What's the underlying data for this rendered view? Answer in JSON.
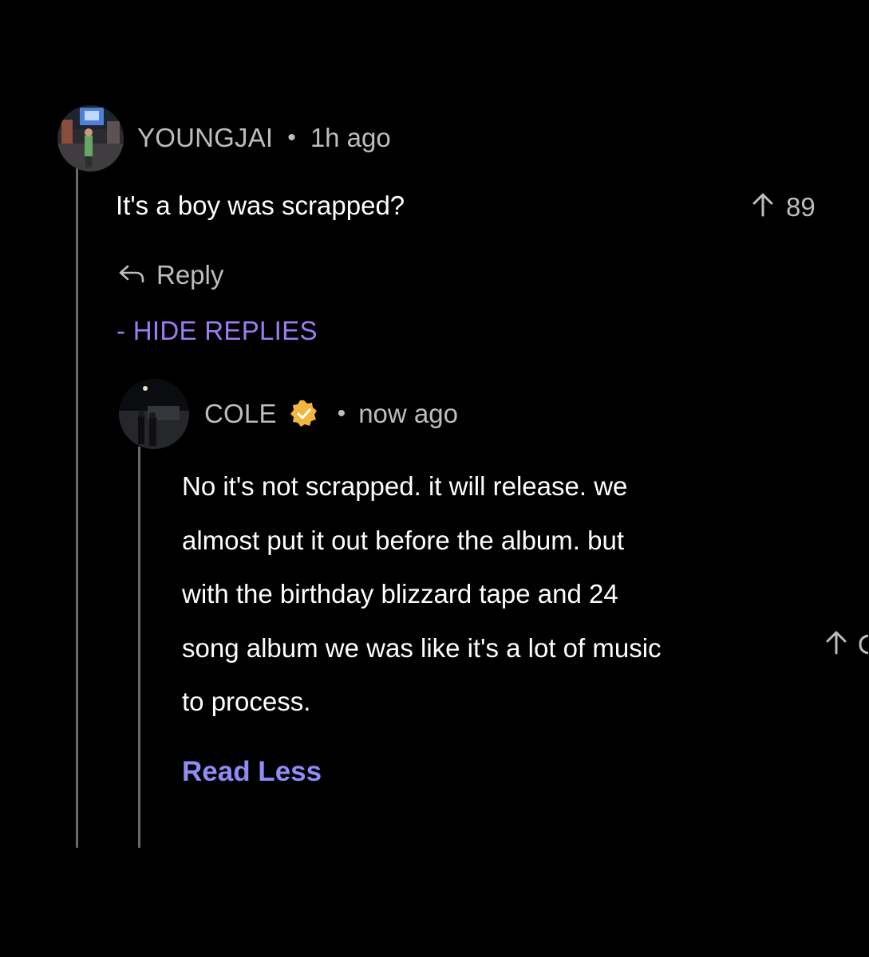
{
  "comment": {
    "username": "YOUNGJAI",
    "separator": "•",
    "time": "1h ago",
    "text": "It's a boy was scrapped?",
    "upvotes": "89",
    "reply_label": "Reply",
    "hide_replies_label": "- HIDE REPLIES"
  },
  "reply": {
    "username": "COLE",
    "verified": true,
    "separator": "•",
    "time": "now ago",
    "text_lines": [
      "No it's not scrapped. it will release. we",
      "almost put it out before the album. but",
      "with the birthday blizzard tape and 24",
      "song album we was like it's a lot of music",
      "to process."
    ],
    "read_less_label": "Read Less"
  },
  "colors": {
    "background": "#000000",
    "meta_text": "#bdbdbd",
    "accent_purple": "#9d7cf5",
    "read_less": "#8f8bf7",
    "verified_badge": "#f2b640",
    "thread_line": "#6a6a6a"
  },
  "icons": {
    "upvote": "arrow-up-icon",
    "reply": "reply-arrow-icon",
    "verified": "verified-badge-icon"
  }
}
